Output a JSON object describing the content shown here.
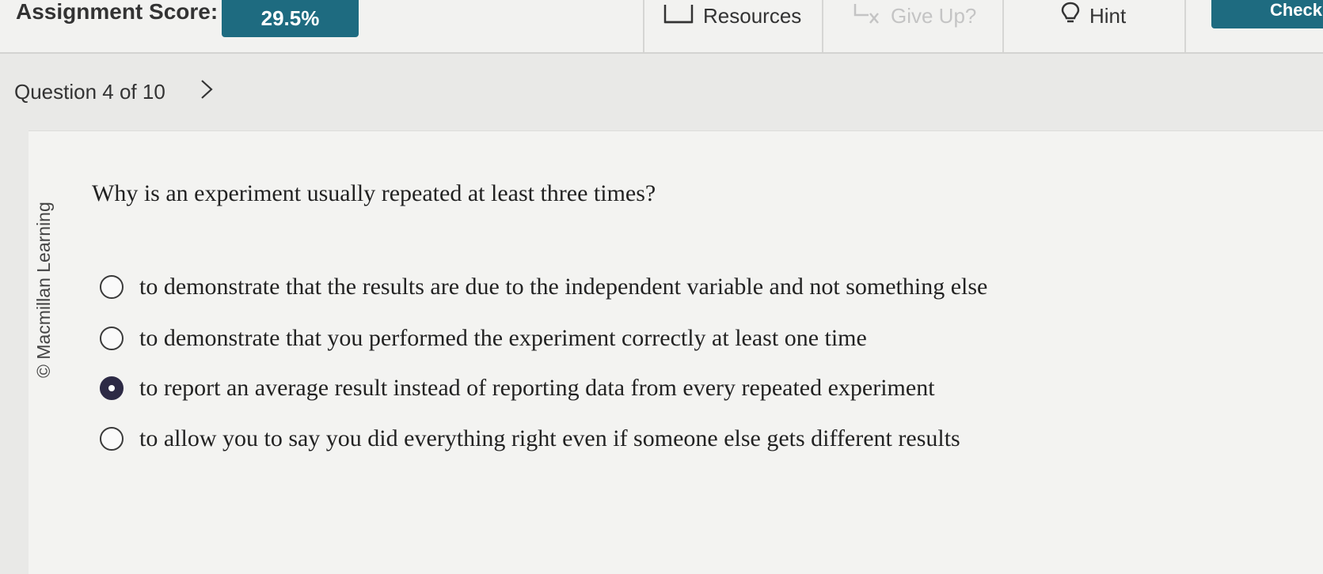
{
  "header": {
    "score_label": "Assignment Score:",
    "score_value": "29.5%",
    "resources_label": "Resources",
    "giveup_label": "Give Up?",
    "hint_label": "Hint",
    "check_label": "Check"
  },
  "nav": {
    "question_counter": "Question 4 of 10"
  },
  "content": {
    "copyright": "© Macmillan Learning",
    "question": "Why is an experiment usually repeated at least three times?",
    "options": [
      {
        "label": "to demonstrate that the results are due to the independent variable and not something else",
        "selected": false
      },
      {
        "label": "to demonstrate that you performed the experiment correctly at least one time",
        "selected": false
      },
      {
        "label": "to report an average result instead of reporting data from every repeated experiment",
        "selected": true
      },
      {
        "label": "to allow you to say you did everything right even if someone else gets different results",
        "selected": false
      }
    ]
  },
  "colors": {
    "accent": "#1e6b80",
    "selected_radio": "#2d2a45",
    "disabled_text": "#c4c4c4"
  },
  "icons": {
    "resources": "book-icon",
    "giveup": "give-up-icon",
    "hint": "lightbulb-icon",
    "next": "chevron-right-icon"
  }
}
